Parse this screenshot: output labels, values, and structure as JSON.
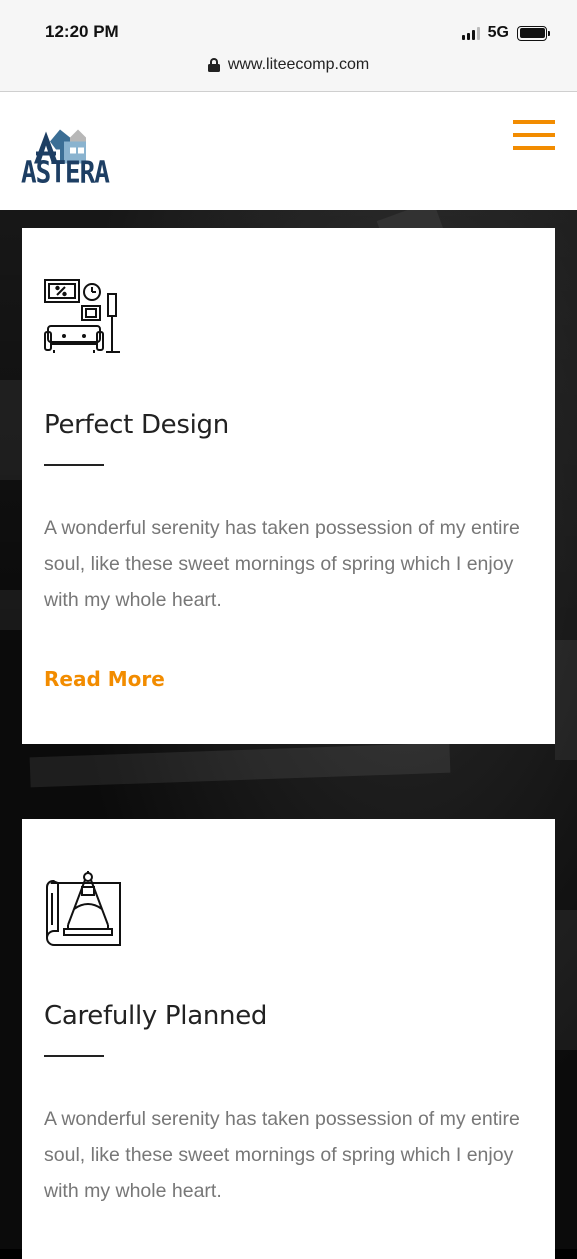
{
  "status_bar": {
    "time": "12:20 PM",
    "network": "5G",
    "icons": [
      "signal-icon",
      "battery-icon"
    ]
  },
  "browser": {
    "url": "www.liteecomp.com",
    "icons": [
      "lock-icon"
    ]
  },
  "header": {
    "logo_text": "ASTERA",
    "menu_icon": "hamburger-menu-icon",
    "accent_color": "#f28c00",
    "brand_color": "#1d3e63"
  },
  "features": [
    {
      "icon": "living-room-furniture-icon",
      "title": "Perfect Design",
      "text": "A wonderful serenity has taken possession of my entire soul, like these sweet mornings of spring which I enjoy with my whole heart.",
      "link": "Read More"
    },
    {
      "icon": "blueprint-compass-icon",
      "title": "Carefully Planned",
      "text": "A wonderful serenity has taken possession of my entire soul, like these sweet mornings of spring which I enjoy with my whole heart."
    }
  ]
}
